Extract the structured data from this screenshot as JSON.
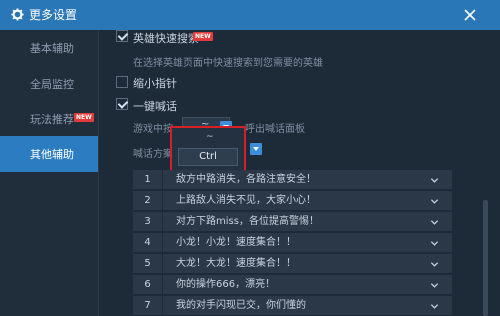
{
  "window": {
    "title": "更多设置",
    "colors": {
      "accent": "#2a77b8",
      "background": "#1d2a38",
      "badge": "#e23b3b",
      "highlight_box": "#d71f27"
    }
  },
  "sidebar": {
    "items": [
      {
        "label": "基本辅助",
        "active": false
      },
      {
        "label": "全局监控",
        "active": false
      },
      {
        "label": "玩法推荐",
        "active": false,
        "badge": "NEW"
      },
      {
        "label": "其他辅助",
        "active": true
      }
    ]
  },
  "options": {
    "hero_search": {
      "label": "英雄快速搜索",
      "checked": true,
      "badge": "NEW",
      "description": "在选择英雄页面中快速搜索到您需要的英雄"
    },
    "minimap": {
      "label": "缩小指针",
      "checked": false
    },
    "quick_shout": {
      "label": "一键喊话",
      "checked": true
    },
    "in_game_prefix": "游戏中按",
    "in_game_suffix": "呼出喊话面板",
    "key_value": "~",
    "scheme_label": "喊话方案",
    "popup": {
      "option_tilde": "~",
      "option_ctrl": "Ctrl"
    }
  },
  "phrases": {
    "rows": [
      {
        "num": "1",
        "text": "敌方中路消失，各路注意安全！"
      },
      {
        "num": "2",
        "text": "上路敌人消失不见，大家小心！"
      },
      {
        "num": "3",
        "text": "对方下路miss，各位提高警惕！"
      },
      {
        "num": "4",
        "text": "小龙！小龙！速度集合！！"
      },
      {
        "num": "5",
        "text": "大龙！大龙！速度集合！！"
      },
      {
        "num": "6",
        "text": "你的操作666，漂亮！"
      },
      {
        "num": "7",
        "text": "我的对手闪现已交，你们懂的"
      }
    ]
  }
}
